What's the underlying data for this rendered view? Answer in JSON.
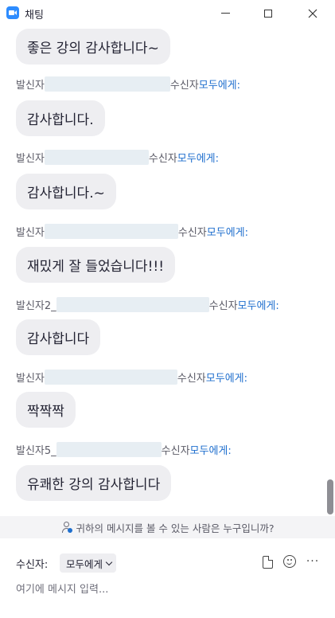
{
  "window": {
    "title": "채팅",
    "app_icon": "zoom-video-icon",
    "controls": [
      "minimize-icon",
      "maximize-icon",
      "close-icon"
    ]
  },
  "messages": [
    {
      "sender_prefix": "",
      "recipient_label": "",
      "recipient": "",
      "text": "좋은 강의 감사합니다~"
    },
    {
      "sender_prefix": "발신자",
      "recipient_label": "수신자",
      "recipient": "모두에게:",
      "text": "감사합니다."
    },
    {
      "sender_prefix": "발신자",
      "recipient_label": "수신자",
      "recipient": "모두에게:",
      "text": "감사합니다.~"
    },
    {
      "sender_prefix": "발신자",
      "recipient_label": "수신자",
      "recipient": "모두에게:",
      "text": "재밌게 잘 들었습니다!!!"
    },
    {
      "sender_prefix": "발신자2_",
      "recipient_label": "수신자",
      "recipient": "모두에게:",
      "text": "감사합니다"
    },
    {
      "sender_prefix": "발신자",
      "recipient_label": "수신자",
      "recipient": "모두에게:",
      "text": "짝짝짝"
    },
    {
      "sender_prefix": "발신자5_",
      "recipient_label": "수신자",
      "recipient": "모두에게:",
      "text": "유쾌한 강의 감사합니다"
    }
  ],
  "who_can_see": {
    "text": "귀하의 메시지를 볼 수 있는 사람은 누구입니까?",
    "icon": "person-info-icon"
  },
  "composer": {
    "to_label": "수신자:",
    "to_value": "모두에게",
    "placeholder": "여기에 메시지 입력...",
    "icons": [
      "file-icon",
      "emoji-icon",
      "more-icon"
    ]
  },
  "colors": {
    "accent": "#1f6fce",
    "bubble": "#eeeef1",
    "redaction": "#e7eef3"
  }
}
